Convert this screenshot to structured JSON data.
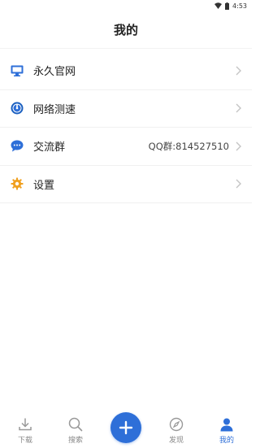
{
  "status_bar": {
    "time": "4:53"
  },
  "header": {
    "title": "我的"
  },
  "menu": [
    {
      "label": "永久官网",
      "value": "",
      "icon": "monitor-icon"
    },
    {
      "label": "网络测速",
      "value": "",
      "icon": "speedometer-icon"
    },
    {
      "label": "交流群",
      "value": "QQ群:814527510",
      "icon": "chat-icon"
    },
    {
      "label": "设置",
      "value": "",
      "icon": "gear-icon"
    }
  ],
  "bottom_nav": [
    {
      "label": "下载",
      "icon": "download-icon",
      "active": false
    },
    {
      "label": "搜索",
      "icon": "search-icon",
      "active": false
    },
    {
      "label": "",
      "icon": "plus-icon",
      "active": false
    },
    {
      "label": "发现",
      "icon": "compass-icon",
      "active": false
    },
    {
      "label": "我的",
      "icon": "user-icon",
      "active": true
    }
  ],
  "colors": {
    "accent": "#2e6fd8",
    "gear": "#f0a020",
    "text": "#222222",
    "muted": "#888888"
  }
}
